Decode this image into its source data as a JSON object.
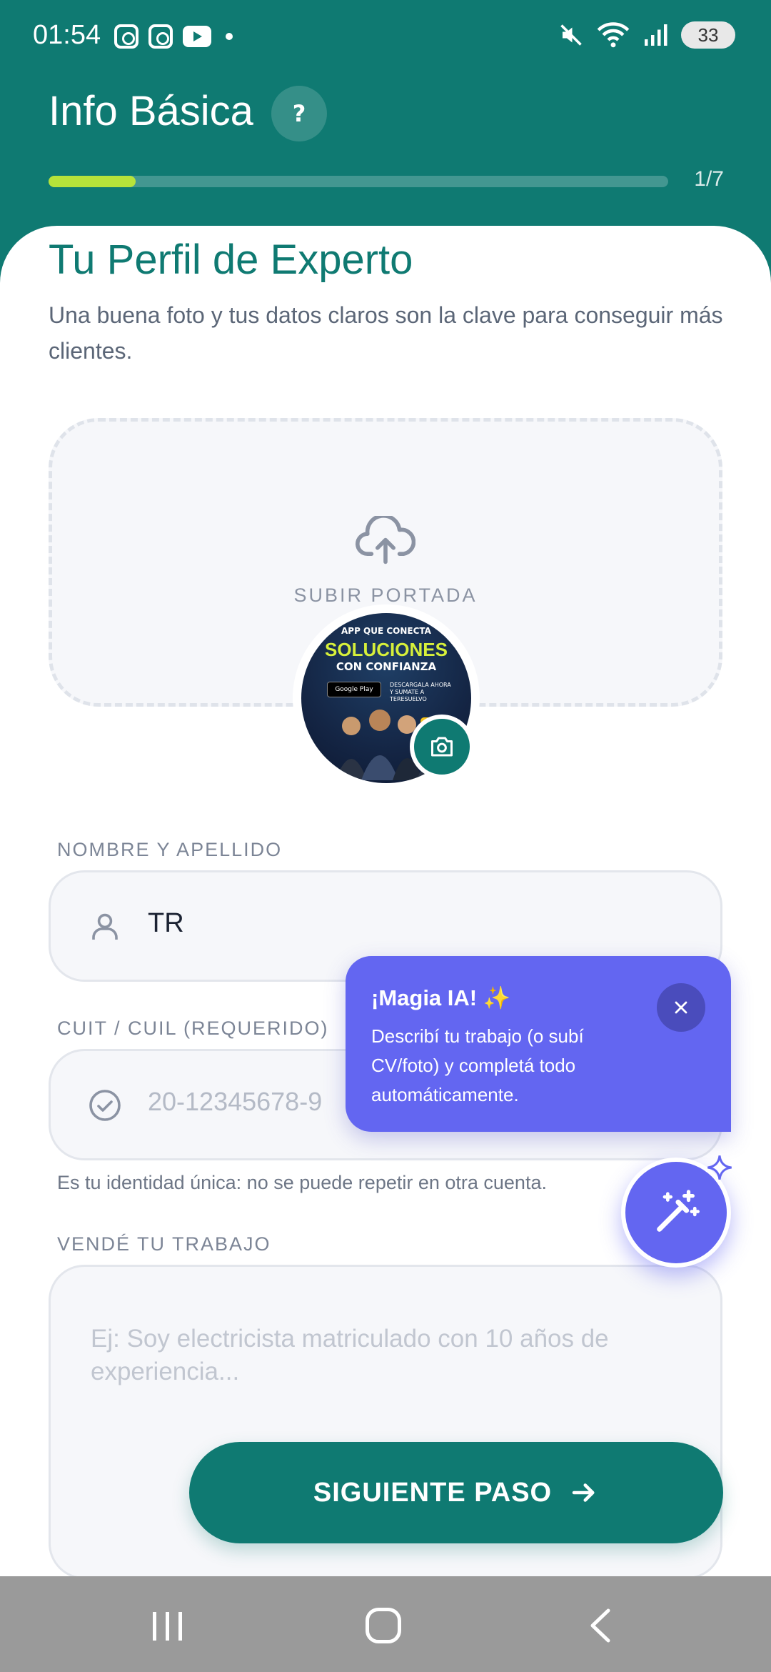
{
  "status_bar": {
    "time": "01:54",
    "battery": "33",
    "icons": [
      "instagram-icon",
      "instagram-icon",
      "youtube-icon",
      "notification-dot",
      "mute-icon",
      "wifi-icon",
      "signal-icon",
      "battery-icon"
    ]
  },
  "header": {
    "title": "Info Básica",
    "help_label": "?",
    "progress_text": "1/7",
    "progress_fraction": 0.14,
    "progress_color": "#b6e33a"
  },
  "intro": {
    "title": "Tu Perfil de Experto",
    "subtitle": "Una buena foto y tus datos claros son la clave para conseguir más clientes."
  },
  "cover": {
    "label": "SUBIR PORTADA",
    "icon": "cloud-upload-icon"
  },
  "avatar": {
    "title1": "APP QUE CONECTA",
    "title2": "SOLUCIONES",
    "title3": "CON CONFIANZA",
    "store_badge": "Google Play",
    "download_text": "DESCARGALA AHORA Y SUMATE A TERESUELVO",
    "camera_icon": "camera-icon"
  },
  "fields": {
    "name": {
      "label": "NOMBRE Y APELLIDO",
      "value": "TR",
      "icon": "user-icon"
    },
    "cuit": {
      "label": "CUIT / CUIL (REQUERIDO)",
      "placeholder": "20-12345678-9",
      "icon": "check-circle-icon",
      "hint": "Es tu identidad única: no se puede repetir en otra cuenta."
    },
    "pitch": {
      "label": "VENDÉ TU TRABAJO",
      "placeholder": "Ej: Soy electricista matriculado con 10 años de experiencia..."
    }
  },
  "ai_tip": {
    "title": "¡Magia IA! ✨",
    "body": "Describí tu trabajo (o subí CV/foto) y completá todo automáticamente.",
    "close_icon": "close-icon",
    "fab_icon": "magic-wand-icon",
    "accent": "#6366f1"
  },
  "next_button": {
    "label": "SIGUIENTE PASO",
    "icon": "arrow-right-icon"
  },
  "theme": {
    "primary": "#0f7a72"
  },
  "navbar": {
    "items": [
      "recent-apps-icon",
      "home-icon",
      "back-icon"
    ]
  }
}
